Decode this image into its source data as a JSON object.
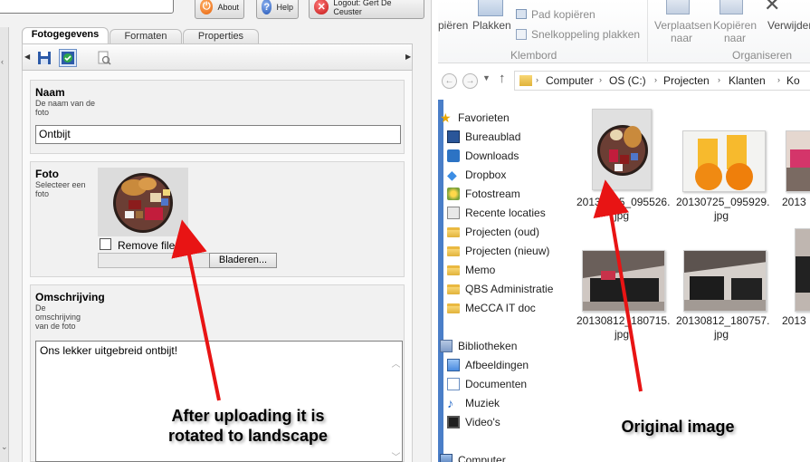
{
  "cms": {
    "top_buttons": {
      "about": "About",
      "help": "Help",
      "logout": "Logout: Gert De Ceuster"
    },
    "tabs": [
      "Fotogegevens",
      "Formaten",
      "Properties"
    ],
    "fields": {
      "naam": {
        "label": "Naam",
        "hint": "De naam van de foto",
        "value": "Ontbijt"
      },
      "foto": {
        "label": "Foto",
        "hint": "Selecteer een foto",
        "remove_label": "Remove file",
        "browse_label": "Bladeren..."
      },
      "omschrijving": {
        "label": "Omschrijving",
        "hint": "De omschrijving van de foto",
        "value": "Ons lekker uitgebreid ontbijt!"
      }
    },
    "caption": "After uploading it is rotated to landscape"
  },
  "explorer": {
    "ribbon": {
      "cut_partial": "piëren",
      "paste": "Plakken",
      "copy_path": "Pad kopiëren",
      "paste_shortcut": "Snelkoppeling plakken",
      "clipboard_group": "Klembord",
      "move_to": "Verplaatsen naar",
      "copy_to": "Kopiëren naar",
      "delete_partial": "Verwijder",
      "organize_group": "Organiseren"
    },
    "breadcrumbs": [
      "Computer",
      "OS (C:)",
      "Projecten",
      "Klanten",
      "Ko"
    ],
    "favorites_header": "Favorieten",
    "favorites": [
      "Bureaublad",
      "Downloads",
      "Dropbox",
      "Fotostream",
      "Recente locaties",
      "Projecten (oud)",
      "Projecten (nieuw)",
      "Memo",
      "QBS Administratie",
      "MeCCA IT doc"
    ],
    "libraries_header": "Bibliotheken",
    "libraries": [
      "Afbeeldingen",
      "Documenten",
      "Muziek",
      "Video's"
    ],
    "computer_header": "Computer",
    "files": [
      {
        "line1": "20130725_095526.",
        "line2": "jpg"
      },
      {
        "line1": "20130725_095929.",
        "line2": "jpg"
      },
      {
        "line1": "2013",
        "line2": ""
      },
      {
        "line1": "20130812_180715.",
        "line2": "jpg"
      },
      {
        "line1": "20130812_180757.",
        "line2": "jpg"
      },
      {
        "line1": "2013",
        "line2": ""
      }
    ],
    "caption": "Original image"
  },
  "colors": {
    "arrow": "#e81414",
    "nav_accent": "#4a7ec8"
  }
}
